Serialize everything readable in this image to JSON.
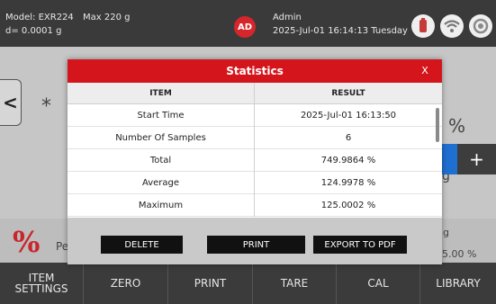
{
  "status_bar": {
    "model": "Model: EXR224",
    "max": "Max 220 g",
    "division": "d= 0.0001 g",
    "avatar_initials": "AD",
    "user": "Admin",
    "datetime": "2025-Jul-01 16:14:13 Tuesday",
    "icons": [
      "usb-icon",
      "wifi-icon",
      "settings-icon"
    ]
  },
  "main_screen": {
    "asterisk": "*",
    "percent_unit": "%",
    "unit_g_right": "g",
    "plus_label": "+",
    "percent_logo": "%",
    "partial_label": "Pe",
    "bottom_right_unit": "g",
    "bottom_right_value": "5.00 %",
    "left_tab_arrow": "<"
  },
  "modal": {
    "title": "Statistics",
    "close_label": "X",
    "columns": [
      "ITEM",
      "RESULT"
    ],
    "rows": [
      {
        "item": "Start Time",
        "result": "2025-Jul-01 16:13:50"
      },
      {
        "item": "Number Of Samples",
        "result": "6"
      },
      {
        "item": "Total",
        "result": "749.9864 %"
      },
      {
        "item": "Average",
        "result": "124.9978 %"
      },
      {
        "item": "Maximum",
        "result": "125.0002 %"
      }
    ],
    "buttons": {
      "delete": "DELETE",
      "print": "PRINT",
      "export": "EXPORT TO PDF"
    }
  },
  "bottom_nav": {
    "item_settings_line1": "ITEM",
    "item_settings_line2": "SETTINGS",
    "zero": "ZERO",
    "print": "PRINT",
    "tare": "TARE",
    "cal": "CAL",
    "library": "LIBRARY"
  },
  "colors": {
    "header_red": "#d4161c",
    "avatar_red": "#d6262c",
    "bar_dark": "#3a3a3a",
    "accent_blue": "#1f6fd0"
  }
}
